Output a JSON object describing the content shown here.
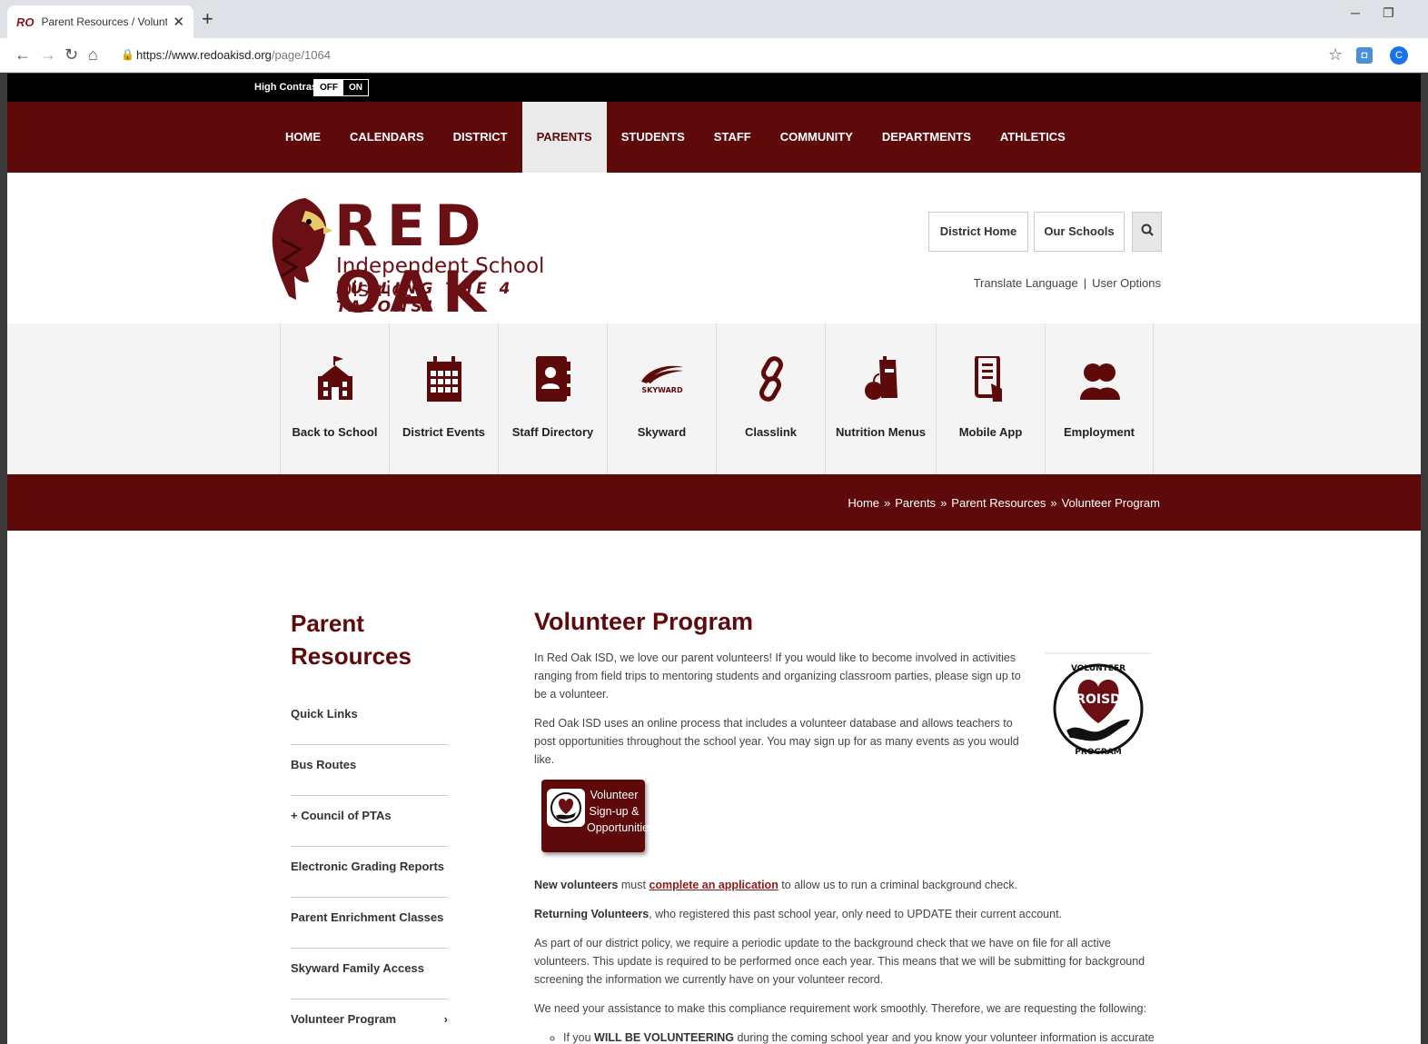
{
  "browser": {
    "tab_title": "Parent Resources / Volunteer Pro",
    "url_host": "https://www.redoakisd.org",
    "url_path": "/page/1064",
    "profile_initial": "C"
  },
  "high_contrast": {
    "label": "High Contrast",
    "off": "OFF",
    "on": "ON"
  },
  "nav": [
    "HOME",
    "CALENDARS",
    "DISTRICT",
    "PARENTS",
    "STUDENTS",
    "STAFF",
    "COMMUNITY",
    "DEPARTMENTS",
    "ATHLETICS"
  ],
  "header": {
    "logo_red": "RED OAK",
    "logo_isd": "Independent School District",
    "logo_tag": "FUELING THE 4 TALONS!",
    "district_home": "District Home",
    "our_schools": "Our Schools",
    "translate": "Translate Language",
    "user_options": "User Options"
  },
  "quick_links": [
    {
      "label": "Back to School",
      "icon": "school-icon"
    },
    {
      "label": "District Events",
      "icon": "calendar-icon"
    },
    {
      "label": "Staff Directory",
      "icon": "directory-icon"
    },
    {
      "label": "Skyward",
      "icon": "skyward-icon",
      "text": "SKYWARD"
    },
    {
      "label": "Classlink",
      "icon": "link-icon"
    },
    {
      "label": "Nutrition Menus",
      "icon": "nutrition-icon"
    },
    {
      "label": "Mobile App",
      "icon": "mobile-icon"
    },
    {
      "label": "Employment",
      "icon": "people-icon"
    }
  ],
  "breadcrumb": [
    "Home",
    "Parents",
    "Parent Resources",
    "Volunteer Program"
  ],
  "sidebar": {
    "title": "Parent Resources",
    "items": [
      {
        "label": "Quick Links"
      },
      {
        "label": "Bus Routes"
      },
      {
        "label": "+ Council of PTAs"
      },
      {
        "label": "Electronic Grading Reports"
      },
      {
        "label": "Parent Enrichment Classes"
      },
      {
        "label": "Skyward Family Access"
      },
      {
        "label": "Volunteer Program",
        "chevron": "›"
      }
    ]
  },
  "main": {
    "title": "Volunteer Program",
    "p1": "In Red Oak ISD, we love our parent volunteers! If you would like to become involved in activities ranging from field trips to mentoring students and organizing classroom parties, please sign up to be a volunteer.",
    "p2": "Red Oak ISD uses an online process that includes a volunteer database and allows teachers to post opportunities throughout the school year. You may sign up for as many events as you would like.",
    "vp_logo_top": "VOLUNTEER",
    "vp_logo_mid": "ROISD",
    "vp_logo_bottom": "PROGRAM",
    "signup_line1": "Volunteer",
    "signup_line2": "Sign-up &",
    "signup_line3": "Opportunities",
    "p3_bold": "New volunteers",
    "p3_mid": " must ",
    "p3_link": "complete an application",
    "p3_end": " to allow us to run a criminal background check.",
    "p4_bold": "Returning Volunteers",
    "p4_end": ", who registered this past school year, only need to UPDATE their current account.",
    "p5": "As part of our district policy, we require a periodic update to the background check that we have on file for all active volunteers. This update is required to be performed once each year. This means that we will be submitting for background screening the information we currently have on your volunteer record.",
    "p6": "We need your assistance to make this compliance requirement work smoothly. Therefore, we are requesting the following:",
    "li1_a": "If you ",
    "li1_bold": "WILL BE VOLUNTEERING",
    "li1_b": " during the coming school year and you know your volunteer information is accurate and up-to-date, you do not need to take any further action. You consent to Red Oak ISD using your information for background screening"
  }
}
